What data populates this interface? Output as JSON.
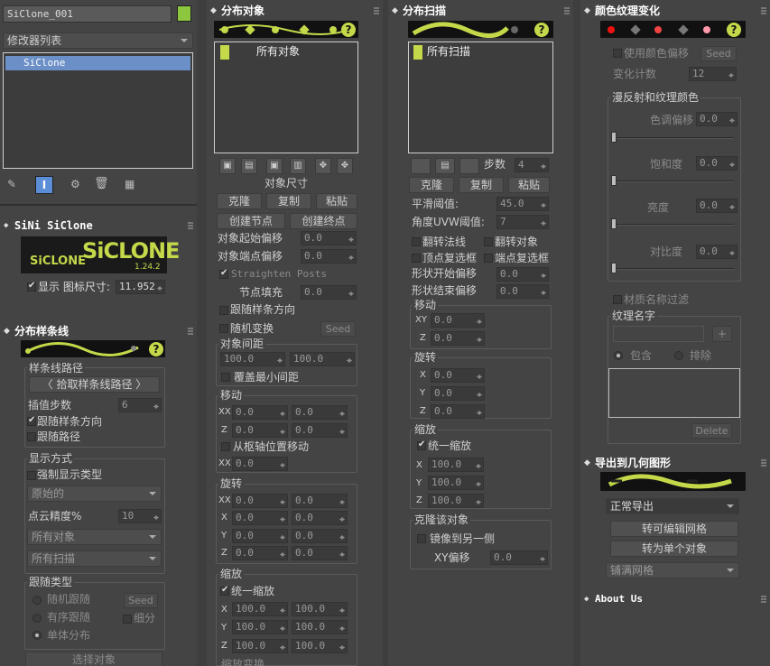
{
  "stack": {
    "object_name": "SiClone_001",
    "color_swatch": "#8dc63f",
    "modifier_list": "修改器列表",
    "modifier_item": "SiClone"
  },
  "siclone": {
    "header": "SiNi SiClone",
    "logo_small": "SiCLONE",
    "logo_big": "SiCLONE",
    "version": "1.24.2",
    "display_label": "显示 图标尺寸:",
    "icon_size": "11.952"
  },
  "spline": {
    "header": "分布样条线",
    "path_group": "样条线路径",
    "pick_button": "〈 拾取样条线路径 〉",
    "interp_label": "插值步数",
    "interp_value": "6",
    "follow_dir": "跟随样条方向",
    "follow_path": "跟随路径",
    "display_group": "显示方式",
    "force_display": "强制显示类型",
    "display_type": "原始的",
    "cloud_label": "点云精度%",
    "cloud_value": "10",
    "all_objects": "所有对象",
    "all_sweeps": "所有扫描",
    "follow_group": "跟随类型",
    "random_follow": "随机跟随",
    "seed": "Seed",
    "ordered_follow": "有序跟随",
    "subdivide": "细分",
    "single_dist": "单体分布",
    "select_obj": "选择对象"
  },
  "distobj": {
    "header": "分布对象",
    "list_item": "所有对象",
    "size_label": "对象尺寸",
    "clone": "克隆",
    "copy": "复制",
    "paste": "粘贴",
    "create_start": "创建节点",
    "create_end": "创建终点",
    "start_offset": "对象起始偏移",
    "start_offset_val": "0.0",
    "end_offset": "对象端点偏移",
    "end_offset_val": "0.0",
    "straighten": "Straighten Posts",
    "node_fill": "节点填充",
    "node_fill_val": "0.0",
    "follow_dir": "跟随样条方向",
    "random_xform": "随机变换",
    "seed": "Seed",
    "spacing_group": "对象间距",
    "spacing_a": "100.0",
    "spacing_b": "100.0",
    "override_min": "覆盖最小间距",
    "move_group": "移动",
    "xx": "XX",
    "x": "X",
    "z": "Z",
    "zero": "0.0",
    "from_pivot": "从枢轴位置移动",
    "rotate_group": "旋转",
    "y": "Y",
    "scale_group": "缩放",
    "uniform": "统一缩放",
    "hundred": "100.0",
    "bottom_cut": "缩放变换"
  },
  "distsweep": {
    "header": "分布扫描",
    "list_item": "所有扫描",
    "steps_label": "步数",
    "steps_val": "4",
    "clone": "克隆",
    "copy": "复制",
    "paste": "粘贴",
    "smooth_label": "平滑阈值:",
    "smooth_val": "45.0",
    "uvw_label": "角度UVW阈值:",
    "uvw_val": "7",
    "flip_normal": "翻转法线",
    "flip_obj": "翻转对象",
    "vertex_sel": "顶点复选框",
    "end_sel": "端点复选框",
    "shape_start": "形状开始偏移",
    "shape_end": "形状结束偏移",
    "zero": "0.0",
    "move_group": "移动",
    "xy": "XY",
    "z": "Z",
    "x": "X",
    "y": "Y",
    "rotate_group": "旋转",
    "scale_group": "缩放",
    "uniform": "统一缩放",
    "hundred": "100.0",
    "clone_group": "克隆该对象",
    "mirror": "镜像到另一侧",
    "xy_offset": "XY偏移"
  },
  "color": {
    "header": "颜色纹理变化",
    "use_offset": "使用颜色偏移",
    "seed": "Seed",
    "count_label": "变化计数",
    "count_val": "12",
    "diffuse_group": "漫反射和纹理颜色",
    "hue": "色调偏移",
    "sat": "饱和度",
    "bright": "亮度",
    "contrast": "对比度",
    "zero": "0.0",
    "mat_filter": "材质名称过滤",
    "tex_group": "纹理名字",
    "plus": "+",
    "include": "包含",
    "exclude": "排除",
    "delete": "Delete"
  },
  "export": {
    "header": "导出到几何图形",
    "mode": "正常导出",
    "to_mesh": "转可编辑网格",
    "to_single": "转为单个对象",
    "tile": "铺满网格"
  },
  "about": {
    "header": "About Us"
  },
  "colors": {
    "accent": "#c4d84a",
    "bg": "#444444",
    "list_border": "#cfcfcf"
  }
}
